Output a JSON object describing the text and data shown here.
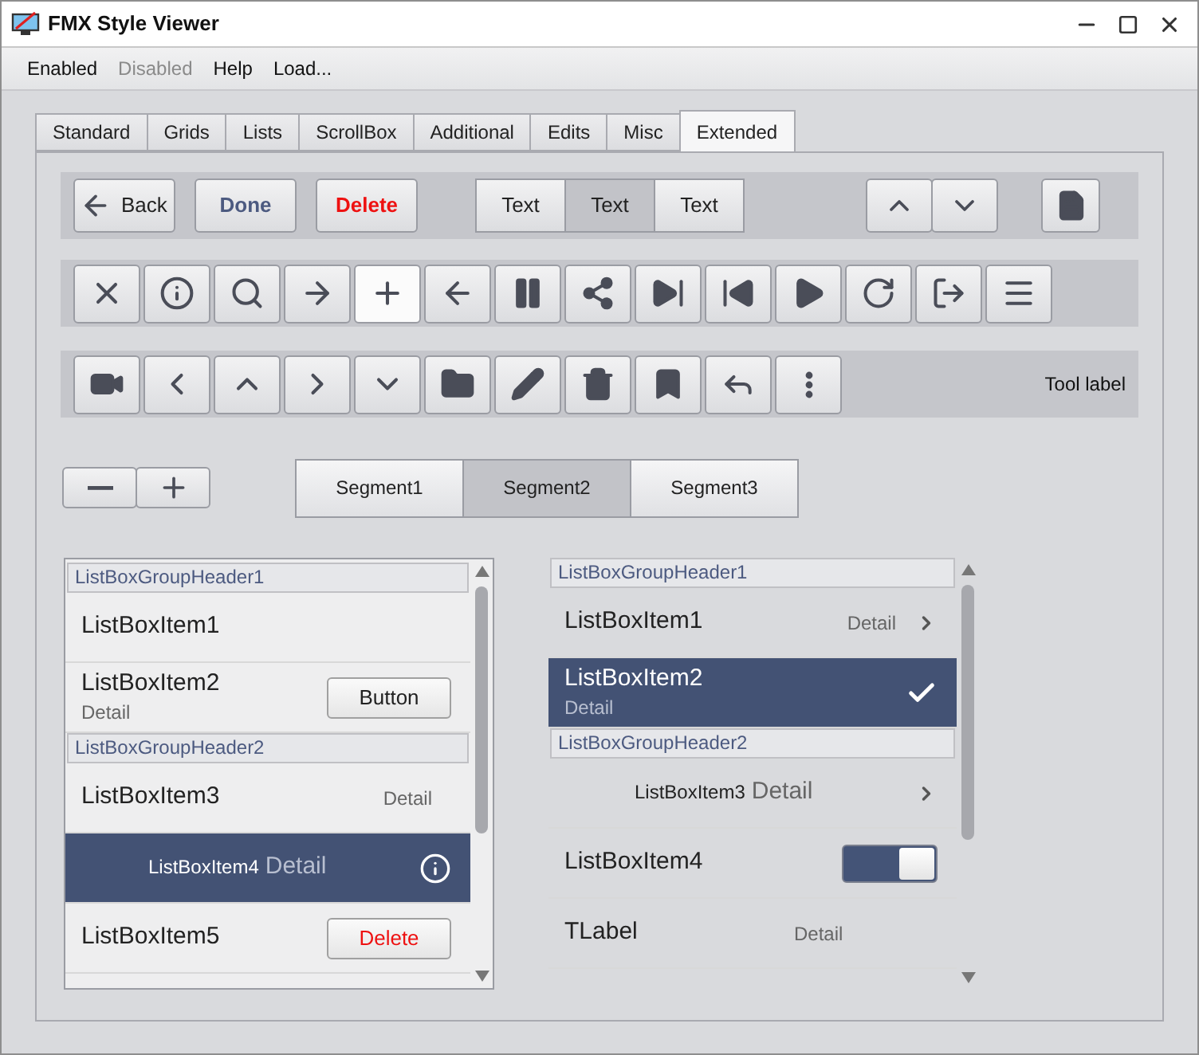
{
  "window": {
    "title": "FMX Style Viewer"
  },
  "menu": [
    {
      "label": "Enabled",
      "disabled": false
    },
    {
      "label": "Disabled",
      "disabled": true
    },
    {
      "label": "Help",
      "disabled": false
    },
    {
      "label": "Load...",
      "disabled": false
    }
  ],
  "tabs": [
    {
      "label": "Standard",
      "selected": false
    },
    {
      "label": "Grids",
      "selected": false
    },
    {
      "label": "Lists",
      "selected": false
    },
    {
      "label": "ScrollBox",
      "selected": false
    },
    {
      "label": "Additional",
      "selected": false
    },
    {
      "label": "Edits",
      "selected": false
    },
    {
      "label": "Misc",
      "selected": false
    },
    {
      "label": "Extended",
      "selected": true
    }
  ],
  "toolbar": {
    "buttons": [
      {
        "kind": "back",
        "label": "Back"
      },
      {
        "kind": "done",
        "label": "Done"
      },
      {
        "kind": "delete",
        "label": "Delete"
      }
    ],
    "segments": [
      {
        "label": "Text",
        "selected": false
      },
      {
        "label": "Text",
        "selected": true
      },
      {
        "label": "Text",
        "selected": false
      }
    ],
    "arrows": [
      {
        "kind": "up"
      },
      {
        "kind": "down"
      }
    ],
    "end_button": {
      "kind": "document"
    }
  },
  "icon_row_1": [
    {
      "kind": "close",
      "highlighted": false
    },
    {
      "kind": "info",
      "highlighted": false
    },
    {
      "kind": "search",
      "highlighted": false
    },
    {
      "kind": "arrow-right",
      "highlighted": false
    },
    {
      "kind": "plus",
      "highlighted": true
    },
    {
      "kind": "arrow-left",
      "highlighted": false
    },
    {
      "kind": "pause",
      "highlighted": false
    },
    {
      "kind": "share",
      "highlighted": false
    },
    {
      "kind": "skip-forward",
      "highlighted": false
    },
    {
      "kind": "skip-back",
      "highlighted": false
    },
    {
      "kind": "play",
      "highlighted": false
    },
    {
      "kind": "refresh",
      "highlighted": false
    },
    {
      "kind": "exit",
      "highlighted": false
    },
    {
      "kind": "menu",
      "highlighted": false
    }
  ],
  "icon_row_2": {
    "buttons": [
      {
        "kind": "video",
        "highlighted": false
      },
      {
        "kind": "chevron-left",
        "highlighted": false
      },
      {
        "kind": "chevron-up",
        "highlighted": false
      },
      {
        "kind": "chevron-right",
        "highlighted": false
      },
      {
        "kind": "chevron-down",
        "highlighted": false
      },
      {
        "kind": "folder",
        "highlighted": false
      },
      {
        "kind": "pencil",
        "highlighted": false
      },
      {
        "kind": "trash",
        "highlighted": false
      },
      {
        "kind": "bookmark",
        "highlighted": false
      },
      {
        "kind": "reply",
        "highlighted": false
      },
      {
        "kind": "more",
        "highlighted": false
      }
    ],
    "label": "Tool label"
  },
  "stepper": [
    {
      "kind": "minus"
    },
    {
      "kind": "plus"
    }
  ],
  "segmented_control": [
    {
      "label": "Segment1",
      "selected": false
    },
    {
      "label": "Segment2",
      "selected": true
    },
    {
      "label": "Segment3",
      "selected": false
    }
  ],
  "left_list": [
    {
      "kind": "header",
      "label": "ListBoxGroupHeader1"
    },
    {
      "kind": "plain",
      "label": "ListBoxItem1",
      "selected": false
    },
    {
      "kind": "detail-below",
      "label": "ListBoxItem2",
      "detail": "Detail",
      "accessory": {
        "kind": "button",
        "label": "Button"
      },
      "selected": false
    },
    {
      "kind": "header",
      "label": "ListBoxGroupHeader2"
    },
    {
      "kind": "detail-right",
      "label": "ListBoxItem3",
      "detail": "Detail",
      "selected": false
    },
    {
      "kind": "detail-inline",
      "label": "ListBoxItem4",
      "detail": "Detail",
      "accessory": {
        "kind": "info"
      },
      "selected": true
    },
    {
      "kind": "plain",
      "label": "ListBoxItem5",
      "accessory": {
        "kind": "delete",
        "label": "Delete"
      },
      "selected": false
    }
  ],
  "right_list": [
    {
      "kind": "header",
      "label": "ListBoxGroupHeader1"
    },
    {
      "kind": "detail-right",
      "label": "ListBoxItem1",
      "detail": "Detail",
      "accessory": {
        "kind": "chevron"
      },
      "selected": false
    },
    {
      "kind": "detail-below",
      "label": "ListBoxItem2",
      "detail": "Detail",
      "accessory": {
        "kind": "check"
      },
      "selected": true
    },
    {
      "kind": "header",
      "label": "ListBoxGroupHeader2"
    },
    {
      "kind": "detail-inline",
      "label": "ListBoxItem3",
      "detail": "Detail",
      "accessory": {
        "kind": "chevron"
      },
      "selected": false
    },
    {
      "kind": "plain",
      "label": "ListBoxItem4",
      "accessory": {
        "kind": "switch",
        "on": true
      },
      "selected": false
    },
    {
      "kind": "detail-center",
      "label": "TLabel",
      "detail": "Detail",
      "selected": false
    }
  ]
}
